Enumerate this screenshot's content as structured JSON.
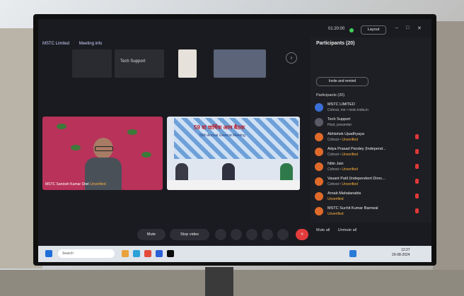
{
  "window": {
    "left_title": "MSTC Limited",
    "meeting_info": "Meeting info",
    "timer": "01:20:00",
    "layout_label": "Layout"
  },
  "thumbnails": [
    {
      "label": ""
    },
    {
      "label": "Tech Support"
    },
    {
      "label": ""
    },
    {
      "label": ""
    }
  ],
  "videos": {
    "left_name": "MSTC Santosh Kumar Shet",
    "left_status": "Unverified",
    "banner_title": "59 वां वार्षिक आम बैठक",
    "banner_sub": "59th Annual General Meeting"
  },
  "panel": {
    "title": "Participants (20)",
    "invite_label": "Invite and remind",
    "list_header": "Participants (20)",
    "participants": [
      {
        "name": "MSTC LIMITED",
        "role": "Cohost, me • mstc.india.in",
        "status": ""
      },
      {
        "name": "Tech Support",
        "role": "Host, presenter",
        "status": ""
      },
      {
        "name": "Abhishek Upadhyaya",
        "role": "Cohost • ",
        "status": "Unverified"
      },
      {
        "name": "Adya Prasad Pandey (Independ...",
        "role": "Cohost • ",
        "status": "Unverified"
      },
      {
        "name": "Nitin Jain",
        "role": "Cohost • ",
        "status": "Unverified"
      },
      {
        "name": "Vasant Patil (Independent Direc...",
        "role": "Cohost • ",
        "status": "Unverified"
      },
      {
        "name": "Arnab Mahalanabis",
        "role": "",
        "status": "Unverified"
      },
      {
        "name": "MSTC Suchit Kumar Barnwal",
        "role": "",
        "status": "Unverified"
      }
    ],
    "mute_all": "Mute all",
    "unmute_all": "Unmute all"
  },
  "controls": {
    "mute": "Mute",
    "stop_video": "Stop video"
  },
  "taskbar": {
    "search_placeholder": "Search",
    "clock_time": "12:27",
    "clock_date": "20-08-2024"
  }
}
